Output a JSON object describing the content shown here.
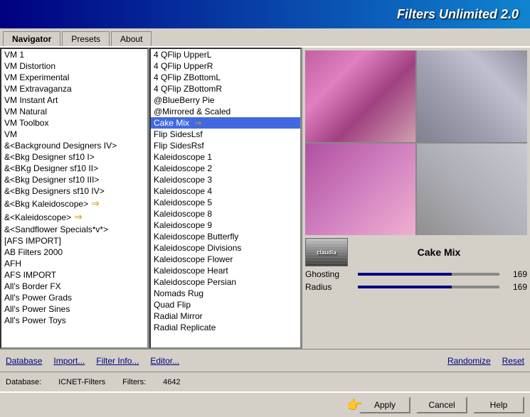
{
  "app": {
    "title": "Filters Unlimited 2.0"
  },
  "tabs": [
    {
      "id": "navigator",
      "label": "Navigator",
      "active": true
    },
    {
      "id": "presets",
      "label": "Presets",
      "active": false
    },
    {
      "id": "about",
      "label": "About",
      "active": false
    }
  ],
  "left_list": {
    "items": [
      "VM 1",
      "VM Distortion",
      "VM Experimental",
      "VM Extravaganza",
      "VM Instant Art",
      "VM Natural",
      "VM Toolbox",
      "VM",
      "&<Background Designers IV>",
      "&<Bkg Designer sf10 I>",
      "&<BKg Designer sf10 II>",
      "&<Bkg Designer sf10 III>",
      "&<Bkg Designers sf10 IV>",
      "&<Bkg Kaleidoscope>",
      "&<Kaleidoscope>",
      "&<Sandflower Specials*v*>",
      "[AFS IMPORT]",
      "AB Filters 2000",
      "AFH",
      "AFS IMPORT",
      "All's Border FX",
      "All's Power Grads",
      "All's Power Sines",
      "All's Power Toys"
    ],
    "selected_index": -1,
    "arrow_items": [
      13,
      14
    ]
  },
  "middle_list": {
    "items": [
      "4 QFlip UpperL",
      "4 QFlip UpperR",
      "4 QFlip ZBottomL",
      "4 QFlip ZBottomR",
      "@BlueBerry Pie",
      "@Mirrored & Scaled",
      "Cake Mix",
      "Flip SidesLsf",
      "Flip SidesRsf",
      "Kaleidoscope 1",
      "Kaleidoscope 2",
      "Kaleidoscope 3",
      "Kaleidoscope 4",
      "Kaleidoscope 5",
      "Kaleidoscope 8",
      "Kaleidoscope 9",
      "Kaleidoscope Butterfly",
      "Kaleidoscope Divisions",
      "Kaleidoscope Flower",
      "Kaleidoscope Heart",
      "Kaleidoscope Persian",
      "Nomads Rug",
      "Quad Flip",
      "Radial Mirror",
      "Radial Replicate"
    ],
    "selected_index": 6,
    "selected_item": "Cake Mix"
  },
  "filter_display": {
    "name": "Cake Mix",
    "icon_text": "claudia"
  },
  "sliders": [
    {
      "label": "Ghosting",
      "value": 169,
      "max": 255
    },
    {
      "label": "Radius",
      "value": 169,
      "max": 255
    }
  ],
  "toolbar": {
    "database_label": "Database",
    "import_label": "Import...",
    "filter_info_label": "Filter Info...",
    "editor_label": "Editor...",
    "randomize_label": "Randomize",
    "reset_label": "Reset"
  },
  "status": {
    "database_label": "Database:",
    "database_value": "ICNET-Filters",
    "filters_label": "Filters:",
    "filters_value": "4642"
  },
  "actions": {
    "apply_label": "Apply",
    "cancel_label": "Cancel",
    "help_label": "Help"
  }
}
